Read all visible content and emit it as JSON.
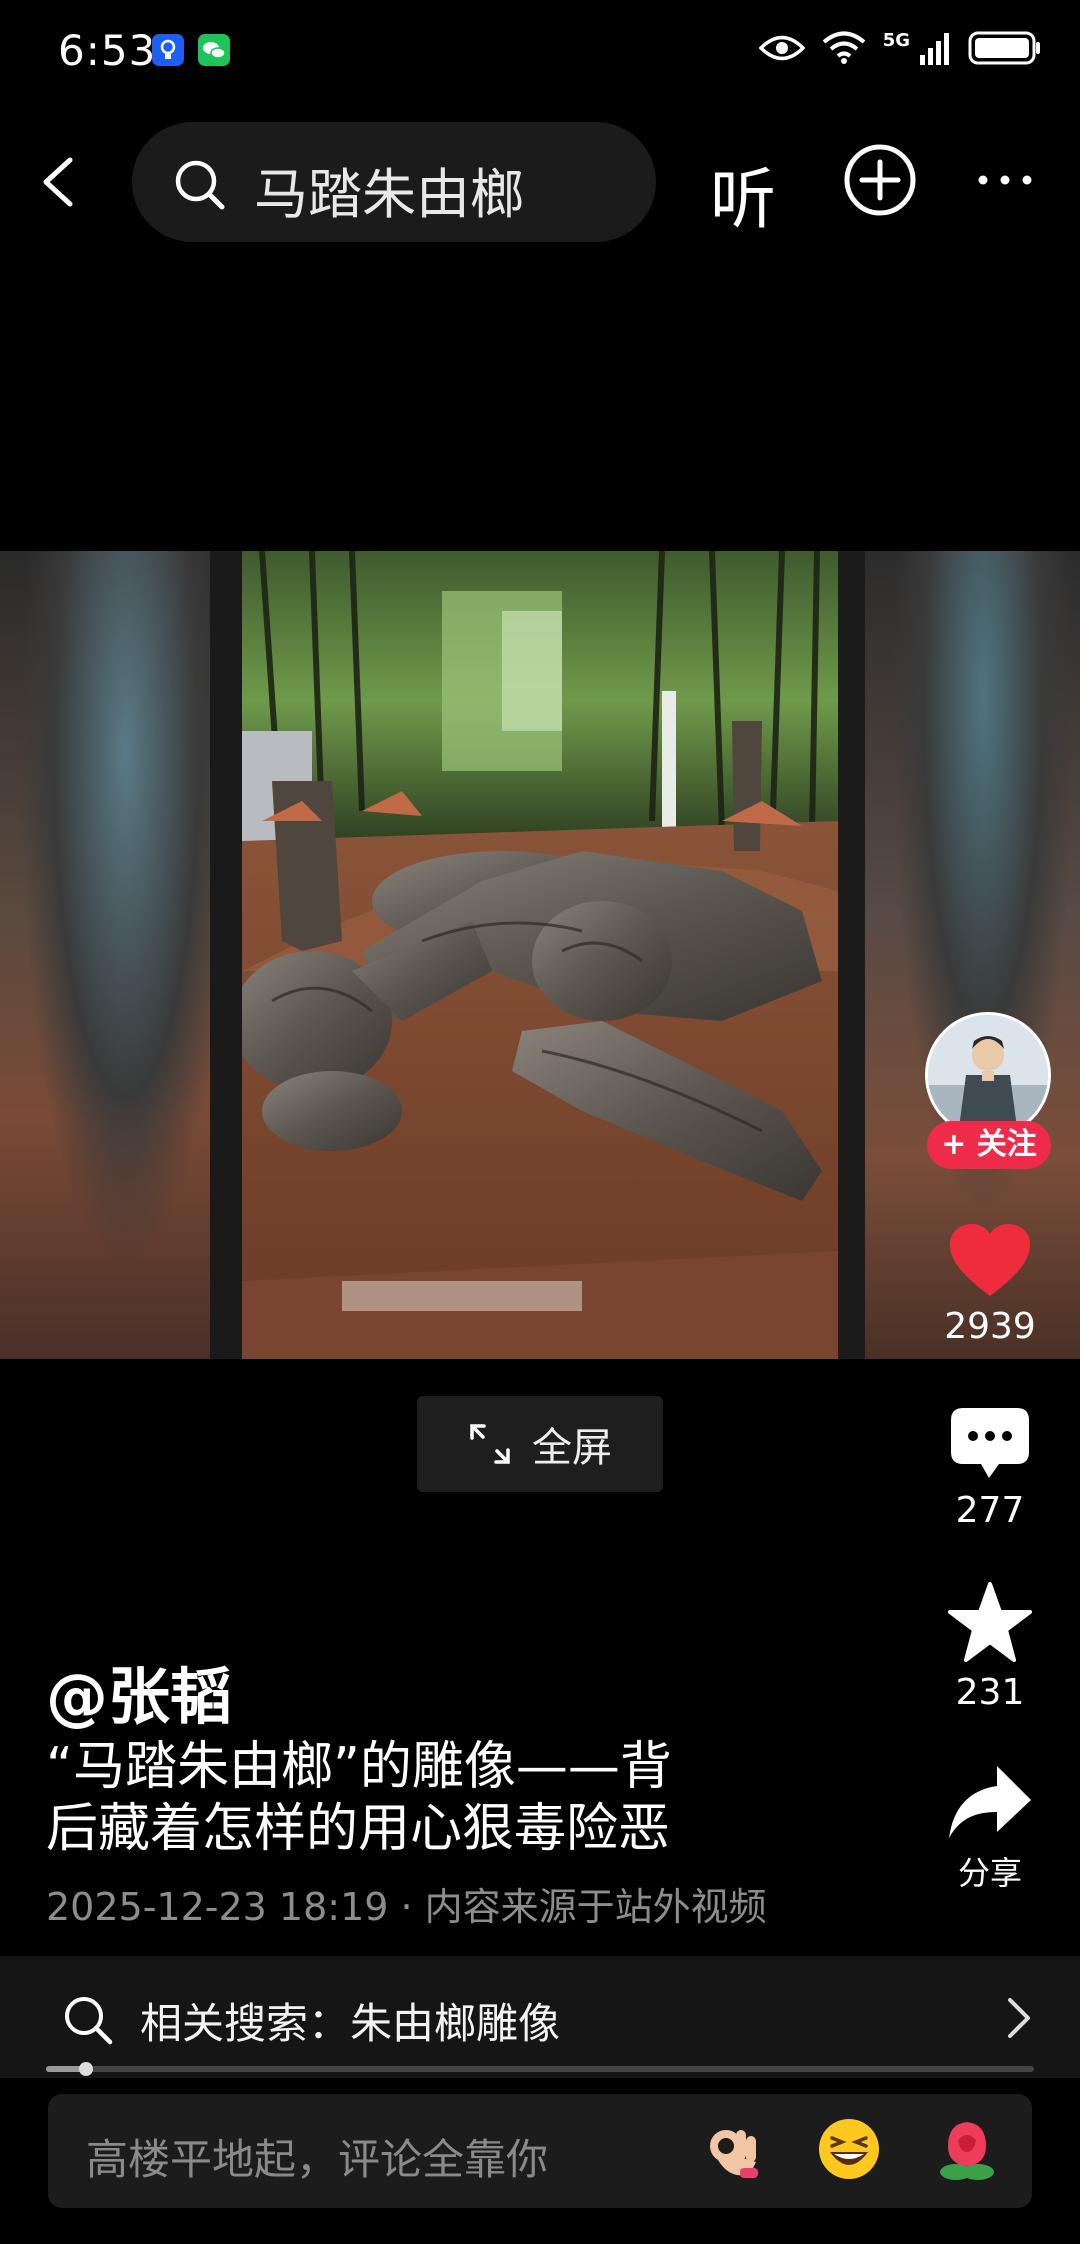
{
  "status_bar": {
    "time": "6:53",
    "network": "5G"
  },
  "nav": {
    "search_query": "马踏朱由榔",
    "listen_label": "听"
  },
  "video": {
    "fullscreen_label": "全屏"
  },
  "actions": {
    "follow_label": "+ 关注",
    "likes": "2939",
    "comments": "277",
    "favorites": "231",
    "share_label": "分享"
  },
  "post": {
    "author": "@张韬",
    "caption": "“马踏朱由榔”的雕像——背后藏着怎样的用心狠毒险恶",
    "meta": "2025-12-23 18:19 · 内容来源于站外视频"
  },
  "related_search": {
    "prefix": "相关搜索：",
    "term": "朱由榔雕像"
  },
  "playback": {
    "progress_fraction": 0.04
  },
  "comment_box": {
    "placeholder": "高楼平地起，评论全靠你"
  },
  "colors": {
    "like": "#ee2c3c",
    "follow": "#ee2c4a",
    "background": "#000000"
  }
}
